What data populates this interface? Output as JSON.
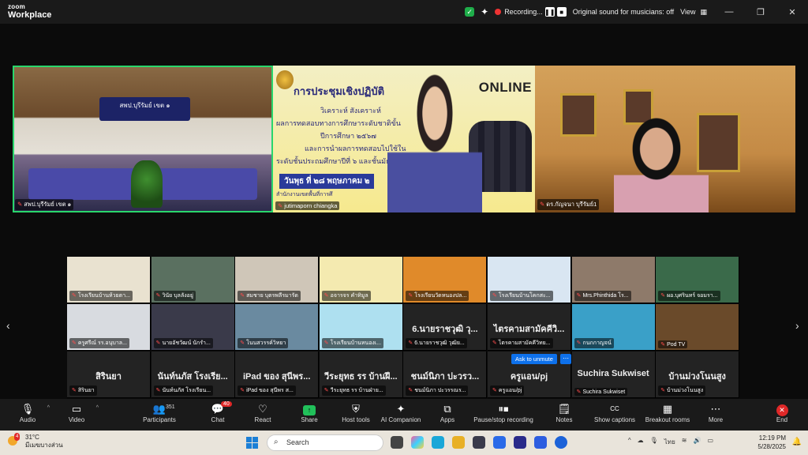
{
  "app": {
    "logo_line1": "zoom",
    "logo_line2": "Workplace"
  },
  "titlebar": {
    "recording": "Recording...",
    "pause": "❚❚",
    "stop": "■",
    "original_sound": "Original sound for musicians: off",
    "view": "View",
    "minimize": "—",
    "restore": "❐",
    "close": "✕"
  },
  "speakers": [
    {
      "name": "สพป.บุรีรัมย์ เขต ๑",
      "banner": "สพป.บุรีรัมย์ เขต ๑"
    },
    {
      "name": "jutimaporn chiangka"
    },
    {
      "name": "ดร.กัญจนา บุรีรัมย์1"
    }
  ],
  "slide": {
    "title": "การประชุมเชิงปฏิบัติ",
    "online": "ONLINE",
    "line1": "วิเคราะห์ สังเคราะห์",
    "line2": "ผลการทดสอบทางการศึกษาระดับชาติขั้น",
    "line3": "ปีการศึกษา ๒๕๖๗",
    "line4": "และการนำผลการทดสอบไปใช้ใน",
    "line5": "ระดับชั้นประถมศึกษาปีที่ ๖ และชั้นมัธย",
    "date": "วันพุธ ที่ ๒๘ พฤษภาคม ๒",
    "footer": "สำนักงานเขตพื้นที่การศึ"
  },
  "gallery": [
    {
      "label": "โรงเรียนบ้านห้วยตา...",
      "big": ""
    },
    {
      "label": "วินัย บุลลังอยู่",
      "big": ""
    },
    {
      "label": "สมชาย บุตรพลีรมารัด",
      "big": ""
    },
    {
      "label": "อจารจร คำทิมูล",
      "big": ""
    },
    {
      "label": "โรงเรียนวัดหนองปล...",
      "big": ""
    },
    {
      "label": "โรงเรียนบ้านโคกสะ...",
      "big": ""
    },
    {
      "label": "Mrs.Phinthida โร...",
      "big": ""
    },
    {
      "label": "ผอ.บุศรินทร์ จอมรา...",
      "big": ""
    },
    {
      "label": "ครูศรีณ์ รร.อนุบาล...",
      "big": ""
    },
    {
      "label": "นายอัชวัฒน์ นักรำ...",
      "big": ""
    },
    {
      "label": "โนนสวรรค์วิทยา",
      "big": ""
    },
    {
      "label": "โรงเรียนบ้านหนองเ...",
      "big": ""
    },
    {
      "label": "6.นายราชวุฒิ วุฒิย...",
      "big": "6.นายราชวุฒิ วุ..."
    },
    {
      "label": "ไตรคามสามัคคีวิทย...",
      "big": "ไตรคามสามัคคีวิ..."
    },
    {
      "label": "กนกกาญจน์",
      "big": ""
    },
    {
      "label": "Pod TV",
      "big": ""
    },
    {
      "label": "สิรินยา",
      "big": "สิรินยา"
    },
    {
      "label": "นันท์นภัส โรงเรียน...",
      "big": "นันท์นภัส โรงเรีย..."
    },
    {
      "label": "iPad ของ สุนีพร ส...",
      "big": "iPad ของ สุนีพร..."
    },
    {
      "label": "วีระยุทธ รร บ้านฝ่าย...",
      "big": "วีระยุทธ รร บ้านฝี..."
    },
    {
      "label": "ชนม์นิภา ปะวรรณร...",
      "big": "ชนม์นิภา ปะวรว..."
    },
    {
      "label": "ครูแอน/pj",
      "big": "ครูแอน/pj"
    },
    {
      "label": "Suchira Sukwiset",
      "big": "Suchira Sukwiset"
    },
    {
      "label": "บ้านม่วงโนนสูง",
      "big": "บ้านม่วงโนนสูง"
    }
  ],
  "ask_to_unmute": "Ask to unmute",
  "more_dots": "⋯",
  "nav": {
    "prev": "‹",
    "next": "›"
  },
  "toolbar": {
    "audio": "Audio",
    "video": "Video",
    "participants": "Participants",
    "participants_count": "351",
    "chat": "Chat",
    "chat_badge": "40",
    "react": "React",
    "share": "Share",
    "host_tools": "Host tools",
    "ai_companion": "AI Companion",
    "apps": "Apps",
    "pause_stop": "Pause/stop recording",
    "notes": "Notes",
    "show_captions": "Show captions",
    "captions_icon": "CC",
    "breakout": "Breakout rooms",
    "more": "More",
    "end": "End"
  },
  "taskbar": {
    "temp": "31°C",
    "weather": "มีเมฆบางส่วน",
    "weather_badge": "4",
    "search": "Search",
    "lang": "ไทย",
    "time": "12:19 PM",
    "date": "5/28/2025"
  },
  "colors": {
    "active_border": "#29d66b",
    "share_green": "#21c05a",
    "end_red": "#e02828",
    "unmute_blue": "#0e71eb"
  }
}
